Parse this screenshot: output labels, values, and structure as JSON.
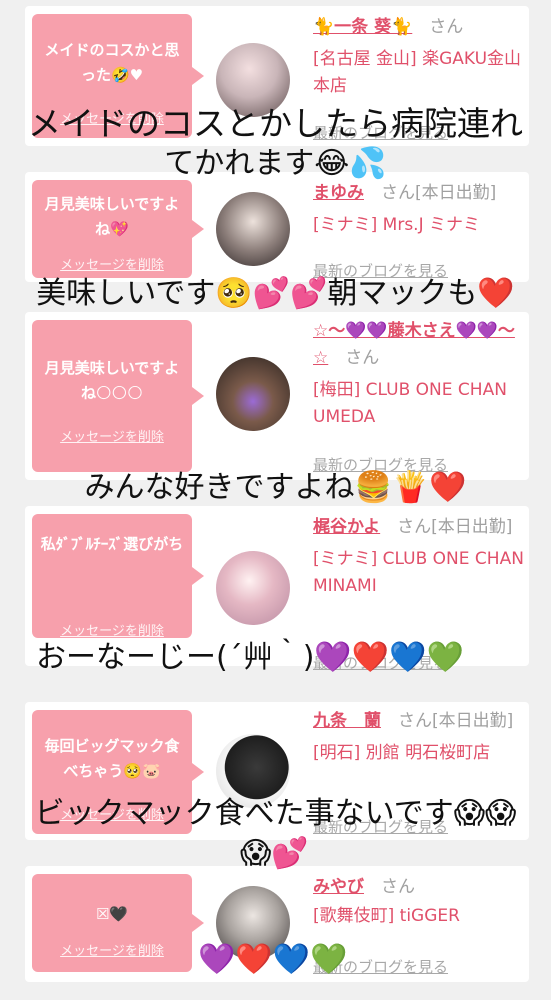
{
  "cards": [
    {
      "message": "メイドのコスかと思った🤣♥",
      "delete_label": "メッセージを削除",
      "name": "🐈一条 葵🐈",
      "san": "さん",
      "status": "",
      "shop": "[名古屋 金山] 楽GAKU金山本店",
      "blog_label": "最新のブログを見る"
    },
    {
      "message": "月見美味しいですよね💖",
      "delete_label": "メッセージを削除",
      "name": "まゆみ",
      "san": "さん",
      "status": "[本日出勤]",
      "shop": "[ミナミ] Mrs.J ミナミ",
      "blog_label": "最新のブログを見る"
    },
    {
      "message": "月見美味しいですよね🌕🌕🌕",
      "delete_label": "メッセージを削除",
      "name": "☆〜💜💜藤木さえ💜💜〜☆",
      "san": "さん",
      "status": "",
      "shop": "[梅田] CLUB ONE CHAN UMEDA",
      "blog_label": "最新のブログを見る"
    },
    {
      "message": "私ﾀﾞﾌﾞﾙﾁｰｽﾞ選びがち",
      "delete_label": "メッセージを削除",
      "name": "梶谷かよ",
      "san": "さん",
      "status": "[本日出勤]",
      "shop": "[ミナミ] CLUB ONE CHAN MINAMI",
      "blog_label": "最新のブログを見る"
    },
    {
      "message": "毎回ビッグマック食べちゃう🥺🐷",
      "delete_label": "メッセージを削除",
      "name": "九条　蘭",
      "san": "さん",
      "status": "[本日出勤]",
      "shop": "[明石] 別館 明石桜町店",
      "blog_label": "最新のブログを見る"
    },
    {
      "message": "☒🖤",
      "delete_label": "メッセージを削除",
      "name": "みやび",
      "san": "さん",
      "status": "",
      "shop": "[歌舞伎町] tiGGER",
      "blog_label": "最新のブログを見る"
    }
  ],
  "overlay": {
    "line1": "メイドのコスとかしたら病院連れ",
    "line2": "てかれます😂💦",
    "line3": "美味しいです🥺💕💕朝マックも❤️",
    "line4": "みんな好きですよね🍔🍟❤️",
    "line5": "おーなーじー(´艸｀)💜❤️💙💚",
    "line6": "ビックマック食べた事ないです😱😱",
    "line7": "😱💕",
    "line8": "💜❤️💙💚"
  },
  "colors": {
    "bubble": "#f7a0ac",
    "name": "#e0506a",
    "background": "#f0f0f0"
  }
}
